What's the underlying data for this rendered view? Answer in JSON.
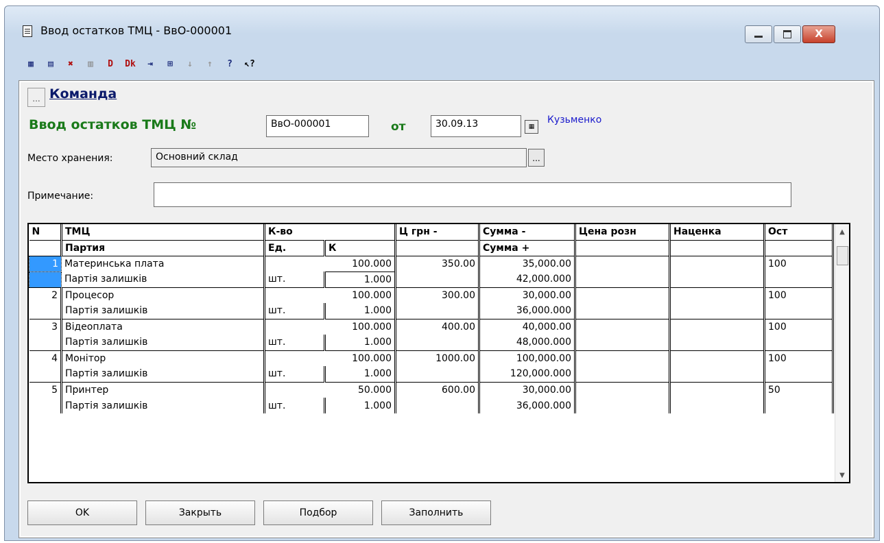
{
  "window": {
    "title": "Ввод остатков ТМЦ - ВвО-000001",
    "min_label": "–",
    "max_label": "□",
    "close_label": "X"
  },
  "toolbar": {
    "icons": [
      "new-row-icon",
      "add-row-icon",
      "delete-row-icon",
      "copy-row-icon",
      "debit-icon",
      "credit-icon",
      "move-icon",
      "insert-icon",
      "sort-az-icon",
      "sort-za-icon",
      "help-icon",
      "whats-this-icon"
    ],
    "glyphs": [
      "▦",
      "▤",
      "✖",
      "▥",
      "D",
      "Dk",
      "⇥",
      "⊞",
      "↓",
      "↑",
      "?",
      "↖?"
    ]
  },
  "command": {
    "button_label": "...",
    "link_label": "Команда"
  },
  "header": {
    "doc_title": "Ввод остатков ТМЦ №",
    "doc_number": "ВвО-000001",
    "date_label": "от",
    "date_value": "30.09.13",
    "author": "Кузьменко"
  },
  "storage": {
    "label": "Место хранения:",
    "value": "Основний склад",
    "button_label": "..."
  },
  "note": {
    "label": "Примечание:",
    "value": ""
  },
  "table": {
    "headers_row1": [
      "N",
      "ТМЦ",
      "К-во",
      "",
      "Ц грн -",
      "Сумма -",
      "Цена розн",
      "Наценка",
      "Ост"
    ],
    "headers_row2": [
      "",
      "Партия",
      "Ед.",
      "К",
      "",
      "Сумма +",
      "",
      "",
      ""
    ],
    "rows": [
      {
        "n": "1",
        "item": "Материнська плата",
        "qty": "100.000",
        "price": "350.00",
        "sum": "35,000.00",
        "retail": "",
        "markup": "",
        "rest": "100",
        "party": "Партія залишків",
        "unit": "шт.",
        "k": "1.000",
        "sum2": "42,000.000"
      },
      {
        "n": "2",
        "item": "Процесор",
        "qty": "100.000",
        "price": "300.00",
        "sum": "30,000.00",
        "retail": "",
        "markup": "",
        "rest": "100",
        "party": "Партія залишків",
        "unit": "шт.",
        "k": "1.000",
        "sum2": "36,000.000"
      },
      {
        "n": "3",
        "item": "Відеоплата",
        "qty": "100.000",
        "price": "400.00",
        "sum": "40,000.00",
        "retail": "",
        "markup": "",
        "rest": "100",
        "party": "Партія залишків",
        "unit": "шт.",
        "k": "1.000",
        "sum2": "48,000.000"
      },
      {
        "n": "4",
        "item": "Монітор",
        "qty": "100.000",
        "price": "1000.00",
        "sum": "100,000.00",
        "retail": "",
        "markup": "",
        "rest": "100",
        "party": "Партія залишків",
        "unit": "шт.",
        "k": "1.000",
        "sum2": "120,000.000"
      },
      {
        "n": "5",
        "item": "Принтер",
        "qty": "50.000",
        "price": "600.00",
        "sum": "30,000.00",
        "retail": "",
        "markup": "",
        "rest": "50",
        "party": "Партія залишків",
        "unit": "шт.",
        "k": "1.000",
        "sum2": "36,000.000"
      }
    ]
  },
  "buttons": {
    "ok": "OK",
    "close": "Закрыть",
    "pick": "Подбор",
    "fill": "Заполнить"
  },
  "colors": {
    "title_green": "#1a7a1a",
    "link_blue": "#0b1a6b",
    "author_blue": "#1a1acc",
    "selection": "#3399ff"
  }
}
